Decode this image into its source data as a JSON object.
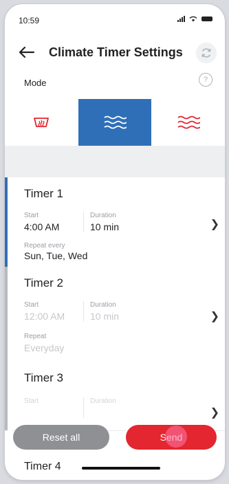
{
  "status": {
    "time": "10:59"
  },
  "header": {
    "title": "Climate Timer Settings"
  },
  "mode": {
    "label": "Mode",
    "help": "?"
  },
  "modes": [
    {
      "name": "defrost",
      "icon": "rear-defrost-icon",
      "color": "#e3262f",
      "active": false
    },
    {
      "name": "cool",
      "icon": "cool-air-icon",
      "color": "#ffffff",
      "active": true
    },
    {
      "name": "heat",
      "icon": "heat-air-icon",
      "color": "#e3262f",
      "active": false
    }
  ],
  "timers": [
    {
      "name": "Timer 1",
      "start_label": "Start",
      "start": "4:00 AM",
      "duration_label": "Duration",
      "duration": "10 min",
      "repeat_label": "Repeat every",
      "repeat": "Sun, Tue, Wed",
      "accent": "#2f6fb8",
      "enabled": true
    },
    {
      "name": "Timer 2",
      "start_label": "Start",
      "start": "12:00 AM",
      "duration_label": "Duration",
      "duration": "10 min",
      "repeat_label": "Repeat",
      "repeat": "Everyday",
      "accent": "#b7b9bd",
      "enabled": false
    },
    {
      "name": "Timer 3",
      "start_label": "Start",
      "duration_label": "Duration",
      "accent": "#b7b9bd",
      "enabled": false
    },
    {
      "name": "Timer 4"
    }
  ],
  "actions": {
    "reset": "Reset all",
    "send": "Send"
  },
  "colors": {
    "accent": "#2f6fb8",
    "danger": "#e3262f",
    "neutral": "#8e9093"
  }
}
